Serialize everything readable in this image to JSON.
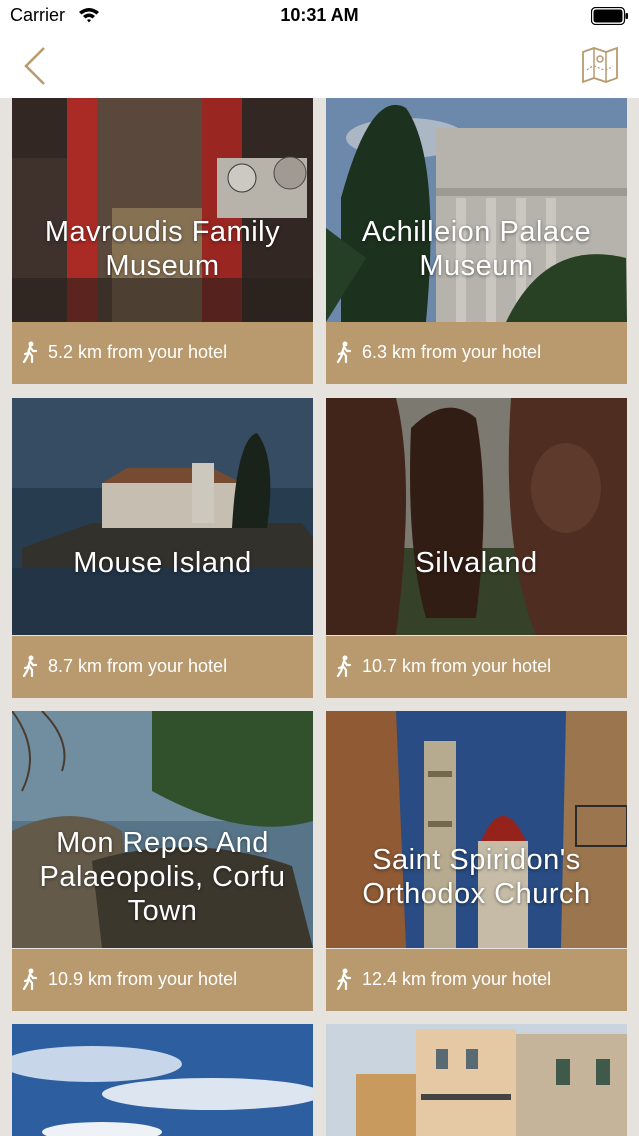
{
  "status_bar": {
    "carrier": "Carrier",
    "time": "10:31 AM"
  },
  "nav": {
    "back_icon": "chevron-left-icon",
    "map_icon": "map-icon"
  },
  "colors": {
    "accent": "#b89a6e",
    "background": "#e6e2de"
  },
  "attractions": [
    {
      "title": "Mavroudis Family Museum",
      "distance": "5.2 km from your hotel"
    },
    {
      "title": "Achilleion Palace Museum",
      "distance": "6.3 km from your hotel"
    },
    {
      "title": "Mouse Island",
      "distance": "8.7 km from your hotel"
    },
    {
      "title": "Silvaland",
      "distance": "10.7 km from your hotel"
    },
    {
      "title": "Mon Repos And Palaeopolis, Corfu Town",
      "distance": "10.9 km from your hotel"
    },
    {
      "title": "Saint Spiridon's Orthodox Church",
      "distance": "12.4 km from your hotel"
    }
  ]
}
